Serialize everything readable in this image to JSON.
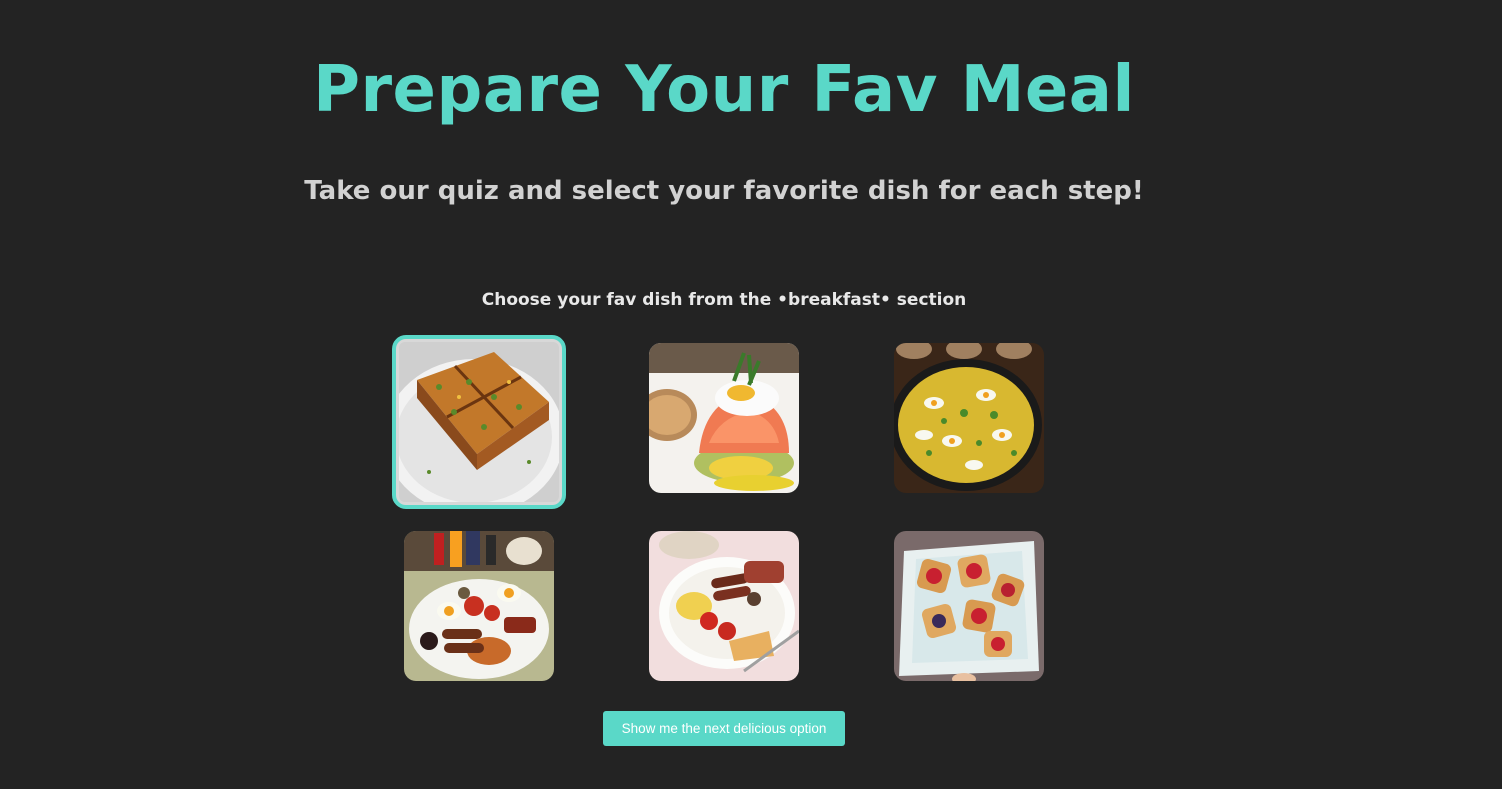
{
  "header": {
    "title": "Prepare Your Fav Meal",
    "subtitle": "Take our quiz and select your favorite dish for each step!"
  },
  "quiz": {
    "prompt": "Choose your fav dish from the •breakfast• section",
    "selected_index": 0,
    "dishes": [
      {
        "icon": "breakfast-casserole-image"
      },
      {
        "icon": "eggs-benedict-salmon-image"
      },
      {
        "icon": "kedgeree-image"
      },
      {
        "icon": "full-english-breakfast-image"
      },
      {
        "icon": "fried-breakfast-plate-image"
      },
      {
        "icon": "fruit-danish-pastries-image"
      }
    ],
    "next_button_label": "Show me the next delicious option"
  },
  "colors": {
    "background": "#232323",
    "accent": "#5ad8c8",
    "subtitle": "#d2d2d2"
  }
}
